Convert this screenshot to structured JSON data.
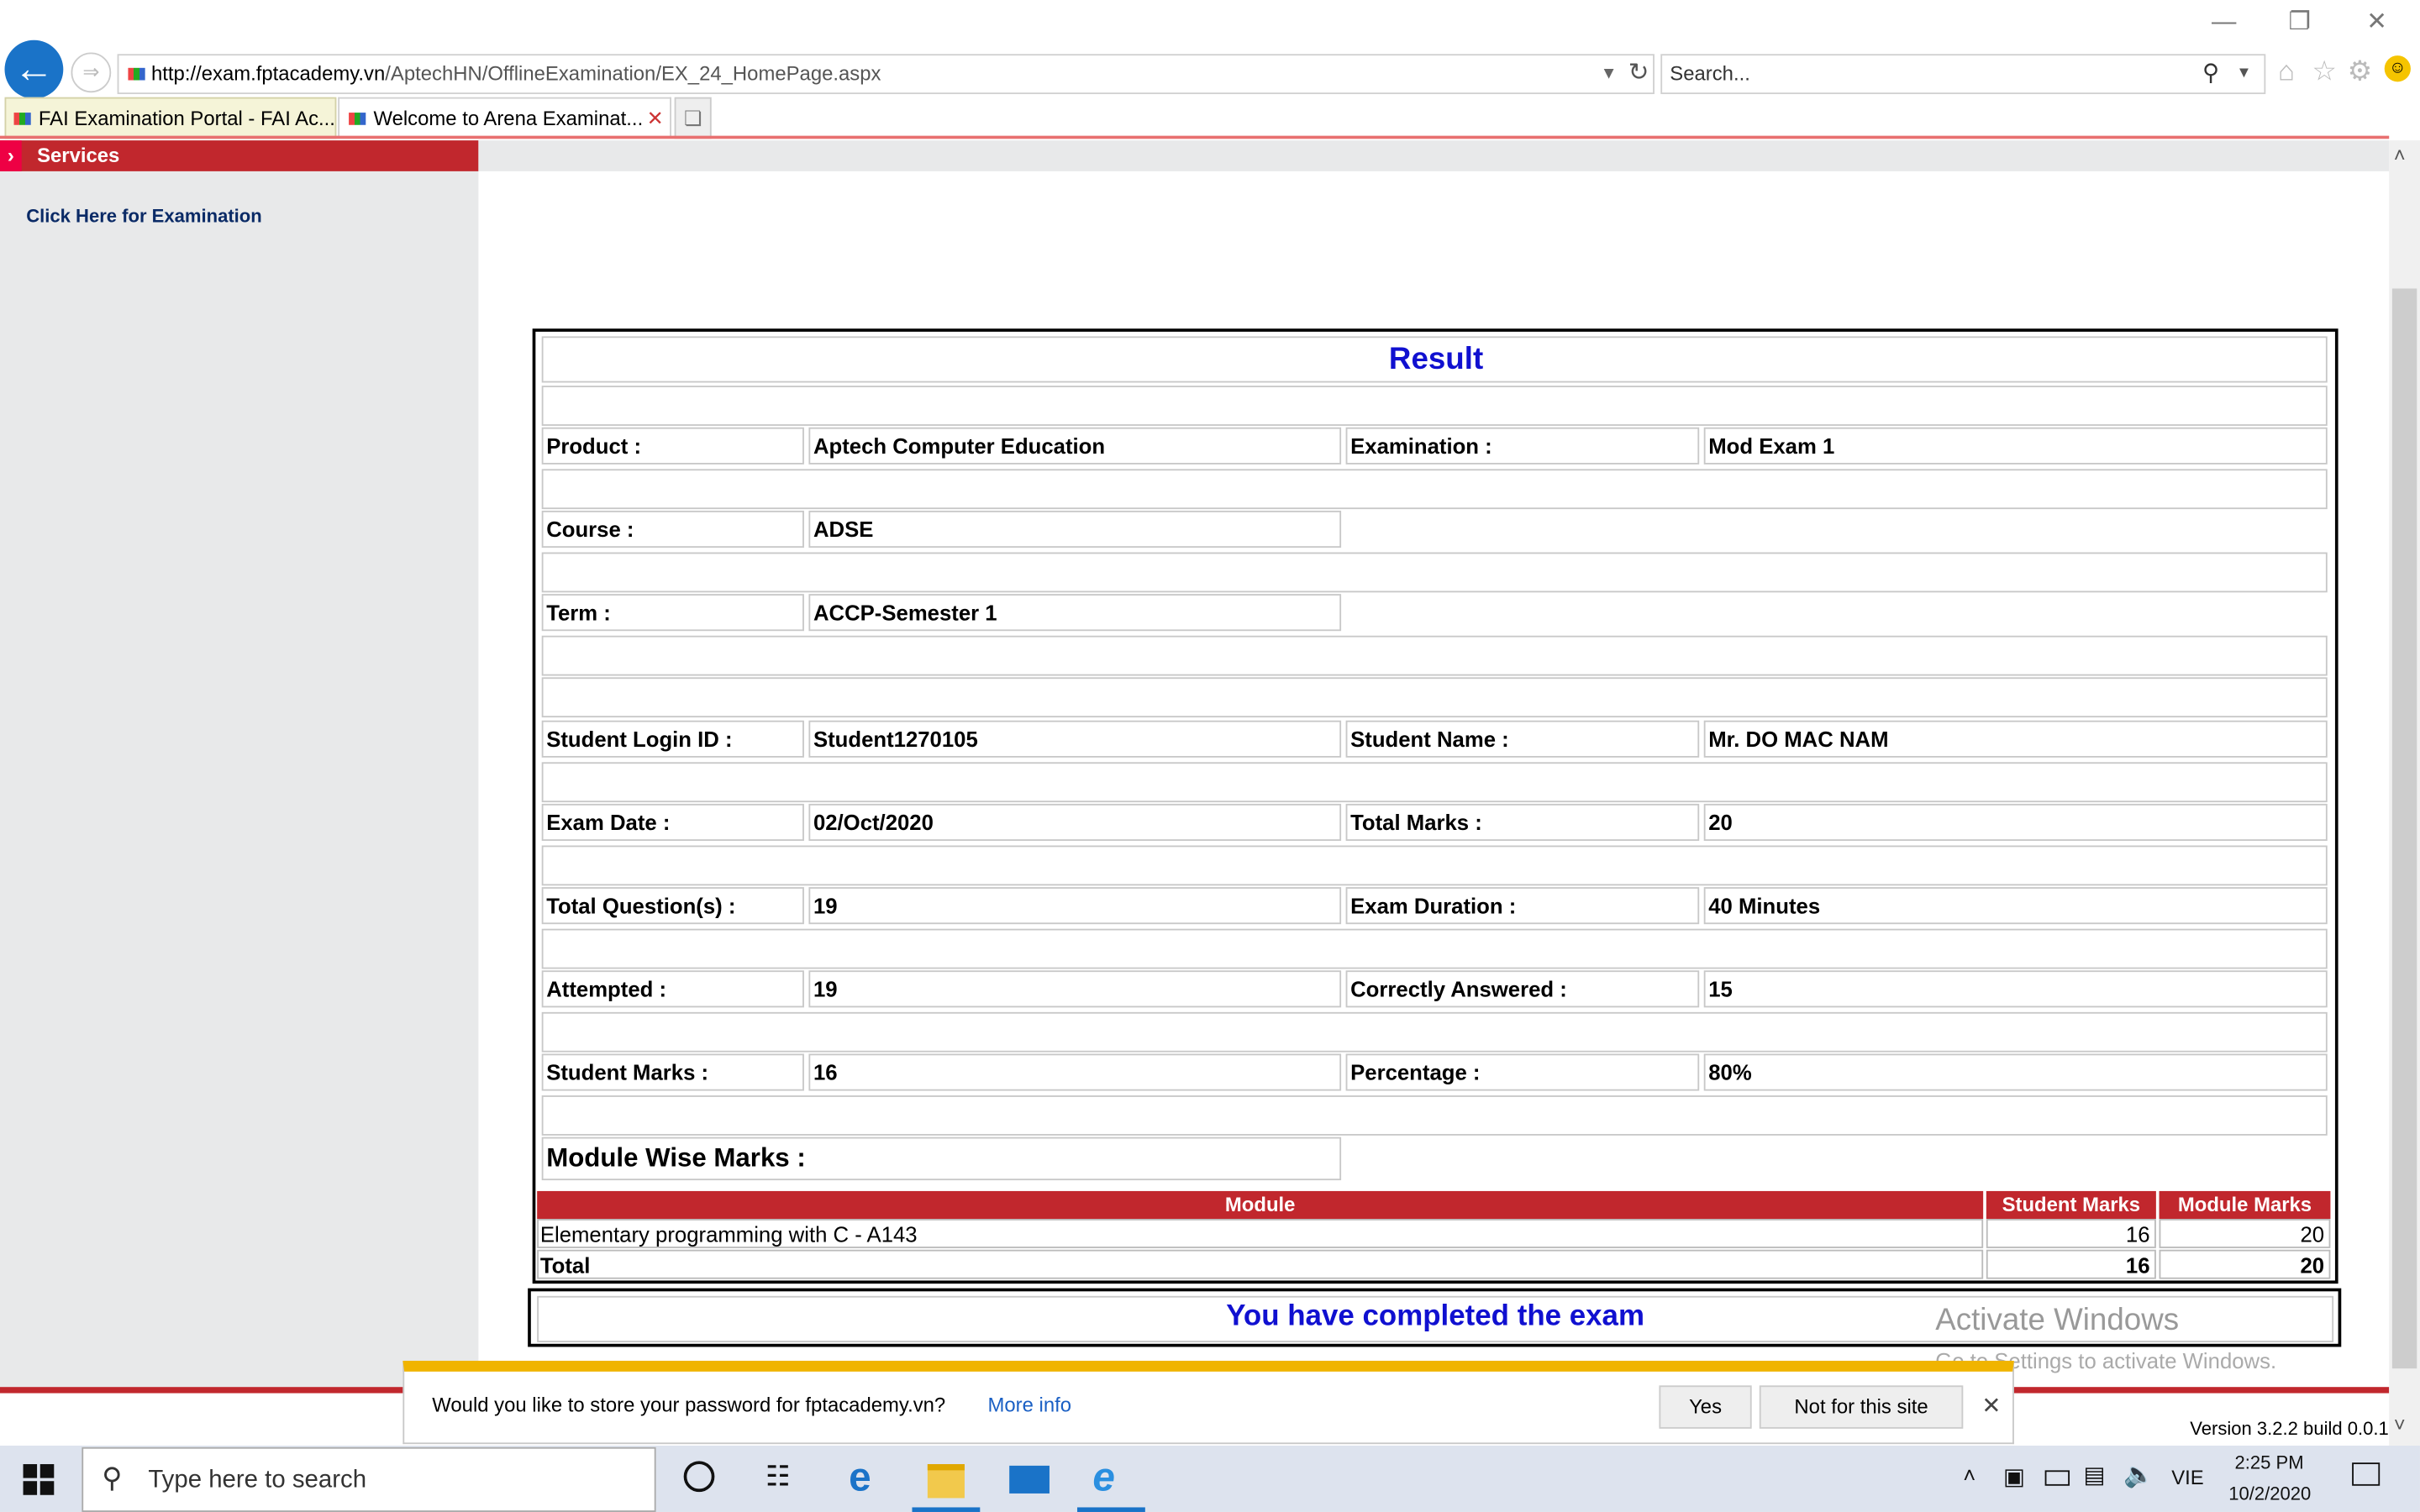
{
  "browser": {
    "url_host": "http://exam.fptacademy.vn",
    "url_path": "/AptechHN/OfflineExamination/EX_24_HomePage.aspx",
    "search_placeholder": "Search...",
    "tabs": [
      {
        "label": "FAI Examination Portal - FAI Ac..."
      },
      {
        "label": "Welcome to Arena Examinat..."
      }
    ]
  },
  "sidebar": {
    "header": "Services",
    "link": "Click Here for Examination"
  },
  "result": {
    "title": "Result",
    "rows": [
      {
        "label": "Product :",
        "value": "Aptech Computer Education",
        "label2": "Examination :",
        "value2": "Mod Exam 1"
      },
      {
        "label": "Course :",
        "value": "ADSE"
      },
      {
        "label": "Term :",
        "value": "ACCP-Semester 1"
      },
      {
        "label": "Student Login ID :",
        "value": "Student1270105",
        "label2": "Student Name :",
        "value2": "Mr. DO MAC NAM"
      },
      {
        "label": "Exam Date :",
        "value": "02/Oct/2020",
        "label2": "Total Marks :",
        "value2": "20"
      },
      {
        "label": "Total Question(s) :",
        "value": "19",
        "label2": "Exam Duration :",
        "value2": "40 Minutes"
      },
      {
        "label": "Attempted :",
        "value": "19",
        "label2": "Correctly Answered :",
        "value2": "15"
      },
      {
        "label": "Student Marks :",
        "value": "16",
        "label2": "Percentage :",
        "value2": "80%"
      }
    ],
    "module_heading": "Module Wise Marks :",
    "module_table": {
      "headers": [
        "Module",
        "Student Marks",
        "Module Marks"
      ],
      "rows": [
        {
          "module": "Elementary programming with C - A143",
          "student_marks": "16",
          "module_marks": "20"
        }
      ],
      "total": {
        "label": "Total",
        "student_marks": "16",
        "module_marks": "20"
      }
    },
    "completed": "You have completed the exam"
  },
  "watermark": {
    "title": "Activate Windows",
    "subtitle": "Go to Settings to activate Windows."
  },
  "version": "Version 3.2.2 build 0.0.1",
  "notification": {
    "message": "Would you like to store your password for fptacademy.vn?",
    "more_info": "More info",
    "yes": "Yes",
    "no": "Not for this site"
  },
  "taskbar": {
    "search_placeholder": "Type here to search",
    "language": "VIE",
    "time": "2:25 PM",
    "date": "10/2/2020"
  },
  "colors": {
    "accent_red": "#c1272d",
    "title_blue": "#1010d0",
    "ie_blue": "#1a73c8"
  }
}
